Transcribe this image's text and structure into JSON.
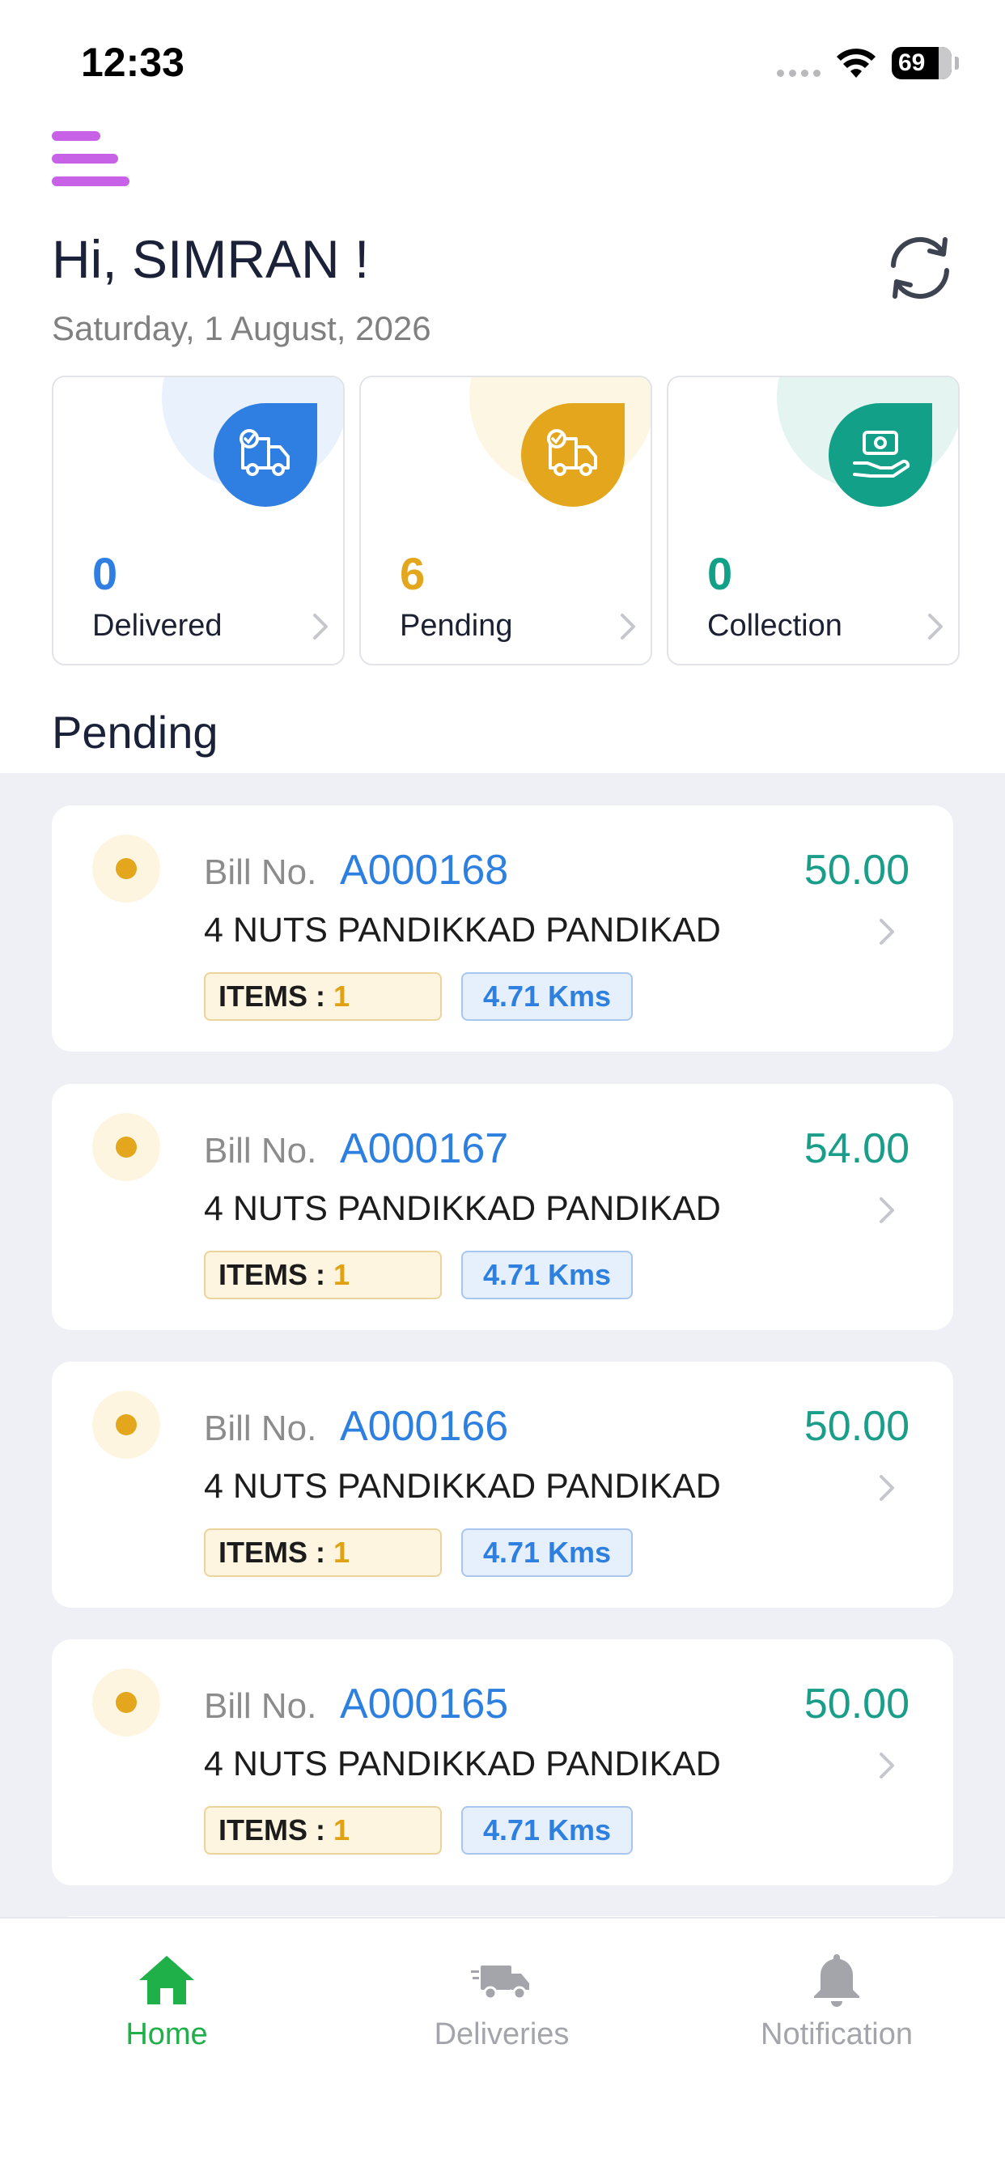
{
  "status_bar": {
    "time": "12:33",
    "battery": "69"
  },
  "header": {
    "greeting": "Hi, SIMRAN !",
    "date": "Saturday, 1 August, 2026"
  },
  "stats": [
    {
      "value": "0",
      "label": "Delivered",
      "color": "#2f7fe2",
      "blob_color": "#e9f1fd",
      "icon": "delivery-truck-check-icon"
    },
    {
      "value": "6",
      "label": "Pending",
      "color": "#e3a61c",
      "blob_color": "#fdf6e2",
      "icon": "pending-truck-icon"
    },
    {
      "value": "0",
      "label": "Collection",
      "color": "#12a089",
      "blob_color": "#e4f5f1",
      "icon": "cash-hand-icon"
    }
  ],
  "section_title": "Pending",
  "orders": [
    {
      "bill_label": "Bill No.",
      "bill_no": "A000168",
      "amount": "50.00",
      "customer": "4 NUTS PANDIKKAD PANDIKAD",
      "items_label": "ITEMS :",
      "items_count": "1",
      "distance": "4.71 Kms"
    },
    {
      "bill_label": "Bill No.",
      "bill_no": "A000167",
      "amount": "54.00",
      "customer": "4 NUTS PANDIKKAD PANDIKAD",
      "items_label": "ITEMS :",
      "items_count": "1",
      "distance": "4.71 Kms"
    },
    {
      "bill_label": "Bill No.",
      "bill_no": "A000166",
      "amount": "50.00",
      "customer": "4 NUTS PANDIKKAD PANDIKAD",
      "items_label": "ITEMS :",
      "items_count": "1",
      "distance": "4.71 Kms"
    },
    {
      "bill_label": "Bill No.",
      "bill_no": "A000165",
      "amount": "50.00",
      "customer": "4 NUTS PANDIKKAD PANDIKAD",
      "items_label": "ITEMS :",
      "items_count": "1",
      "distance": "4.71 Kms"
    }
  ],
  "nav": [
    {
      "label": "Home",
      "icon": "home-icon",
      "active": true
    },
    {
      "label": "Deliveries",
      "icon": "delivery-truck-icon",
      "active": false
    },
    {
      "label": "Notification",
      "icon": "bell-icon",
      "active": false
    }
  ],
  "colors": {
    "accent_menu": "#c761e6",
    "nav_active": "#1fb04a",
    "nav_inactive": "#a3a5ab",
    "bill_no": "#2d7fe0",
    "amount": "#1a9e8a"
  }
}
